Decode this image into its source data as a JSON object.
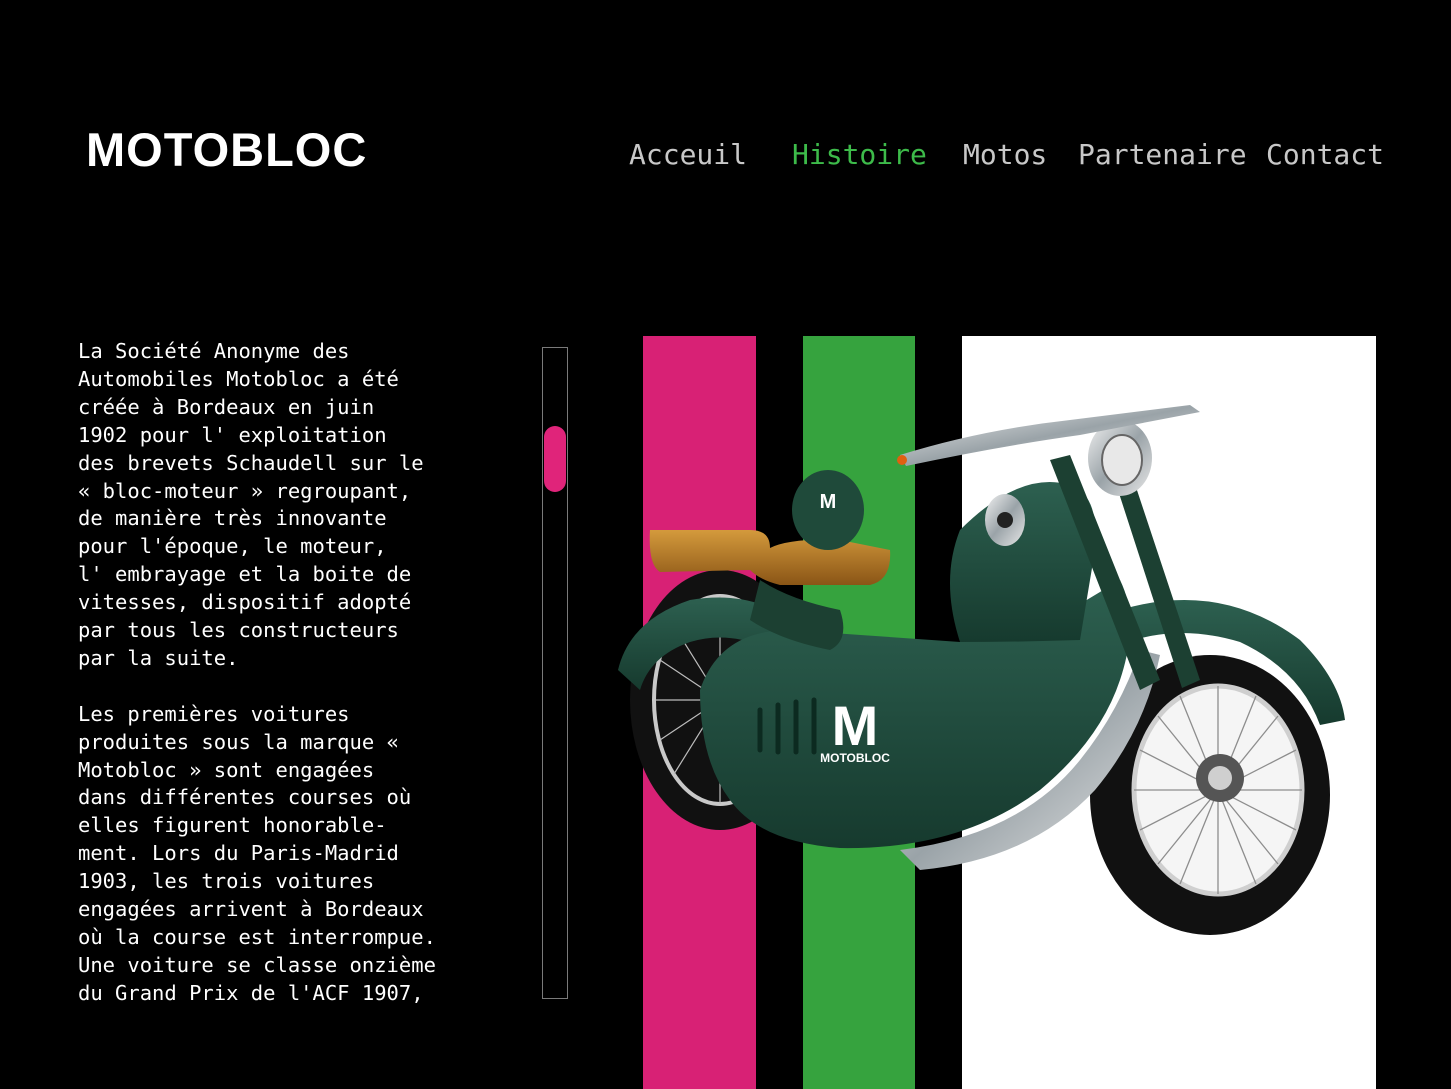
{
  "header": {
    "logo": "MOTOBLOC",
    "nav": [
      {
        "label": "Acceuil",
        "active": false
      },
      {
        "label": "Histoire",
        "active": true
      },
      {
        "label": "Motos",
        "active": false
      },
      {
        "label": "Partenaire",
        "active": false
      },
      {
        "label": "Contact",
        "active": false
      }
    ]
  },
  "content": {
    "paragraph_1": "La Société Anonyme des\nAutomobiles Motobloc a été\ncréée à Bordeaux en juin\n1902 pour l' exploitation\ndes brevets Schaudell sur le\n« bloc-moteur » regroupant,\nde manière très innovante\npour l'époque, le moteur,\nl' embrayage et la boite de\nvitesses, dispositif adopté\npar tous les constructeurs\npar la suite.",
    "paragraph_2": "Les premières voitures\nproduites sous la marque «\nMotobloc » sont engagées\ndans différentes courses où\nelles figurent honorable-\nment. Lors du Paris-Madrid\n1903, les trois voitures\nengagées arrivent à Bordeaux\noù la course est interrompue.\nUne voiture se classe onzième\ndu Grand Prix de l'ACF 1907,"
  },
  "motorcycle": {
    "badge_letter": "M",
    "badge_text": "MOTOBLOC"
  },
  "colors": {
    "accent_green": "#3dbb4a",
    "stripe_pink": "#d82175",
    "stripe_green": "#36a33e",
    "bike_green": "#1f4a3a",
    "scroll_thumb": "#e0247a"
  }
}
